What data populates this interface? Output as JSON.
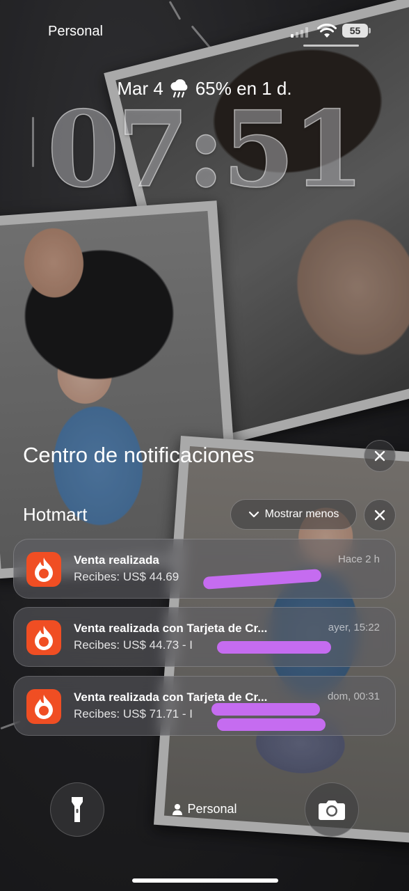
{
  "status_bar": {
    "carrier": "Personal",
    "battery_level": "55",
    "icons": [
      "cellular-signal-icon",
      "wifi-icon",
      "battery-icon"
    ]
  },
  "lockscreen": {
    "date": "Mar 4",
    "weather_icon": "rain-cloud-icon",
    "weather_text": "65% en 1 d.",
    "time": "07:51"
  },
  "notification_center": {
    "title": "Centro de notificaciones",
    "group": {
      "app_name": "Hotmart",
      "show_less_label": "Mostrar menos",
      "notifications": [
        {
          "title": "Venta realizada",
          "body": "Recibes: US$ 44.69",
          "time": "Hace 2 h",
          "icon": "hotmart-flame-icon"
        },
        {
          "title": "Venta realizada con Tarjeta de Cr...",
          "body": "Recibes: US$ 44.73 - I",
          "time": "ayer, 15:22",
          "icon": "hotmart-flame-icon"
        },
        {
          "title": "Venta realizada con Tarjeta de Cr...",
          "body": "Recibes: US$ 71.71 - I",
          "time": "dom, 00:31",
          "icon": "hotmart-flame-icon"
        }
      ]
    }
  },
  "bottom": {
    "focus_mode": "Personal",
    "left_action": "flashlight-icon",
    "right_action": "camera-icon"
  },
  "colors": {
    "hotmart_orange": "#f04e23",
    "redaction": "#c56cf0"
  }
}
